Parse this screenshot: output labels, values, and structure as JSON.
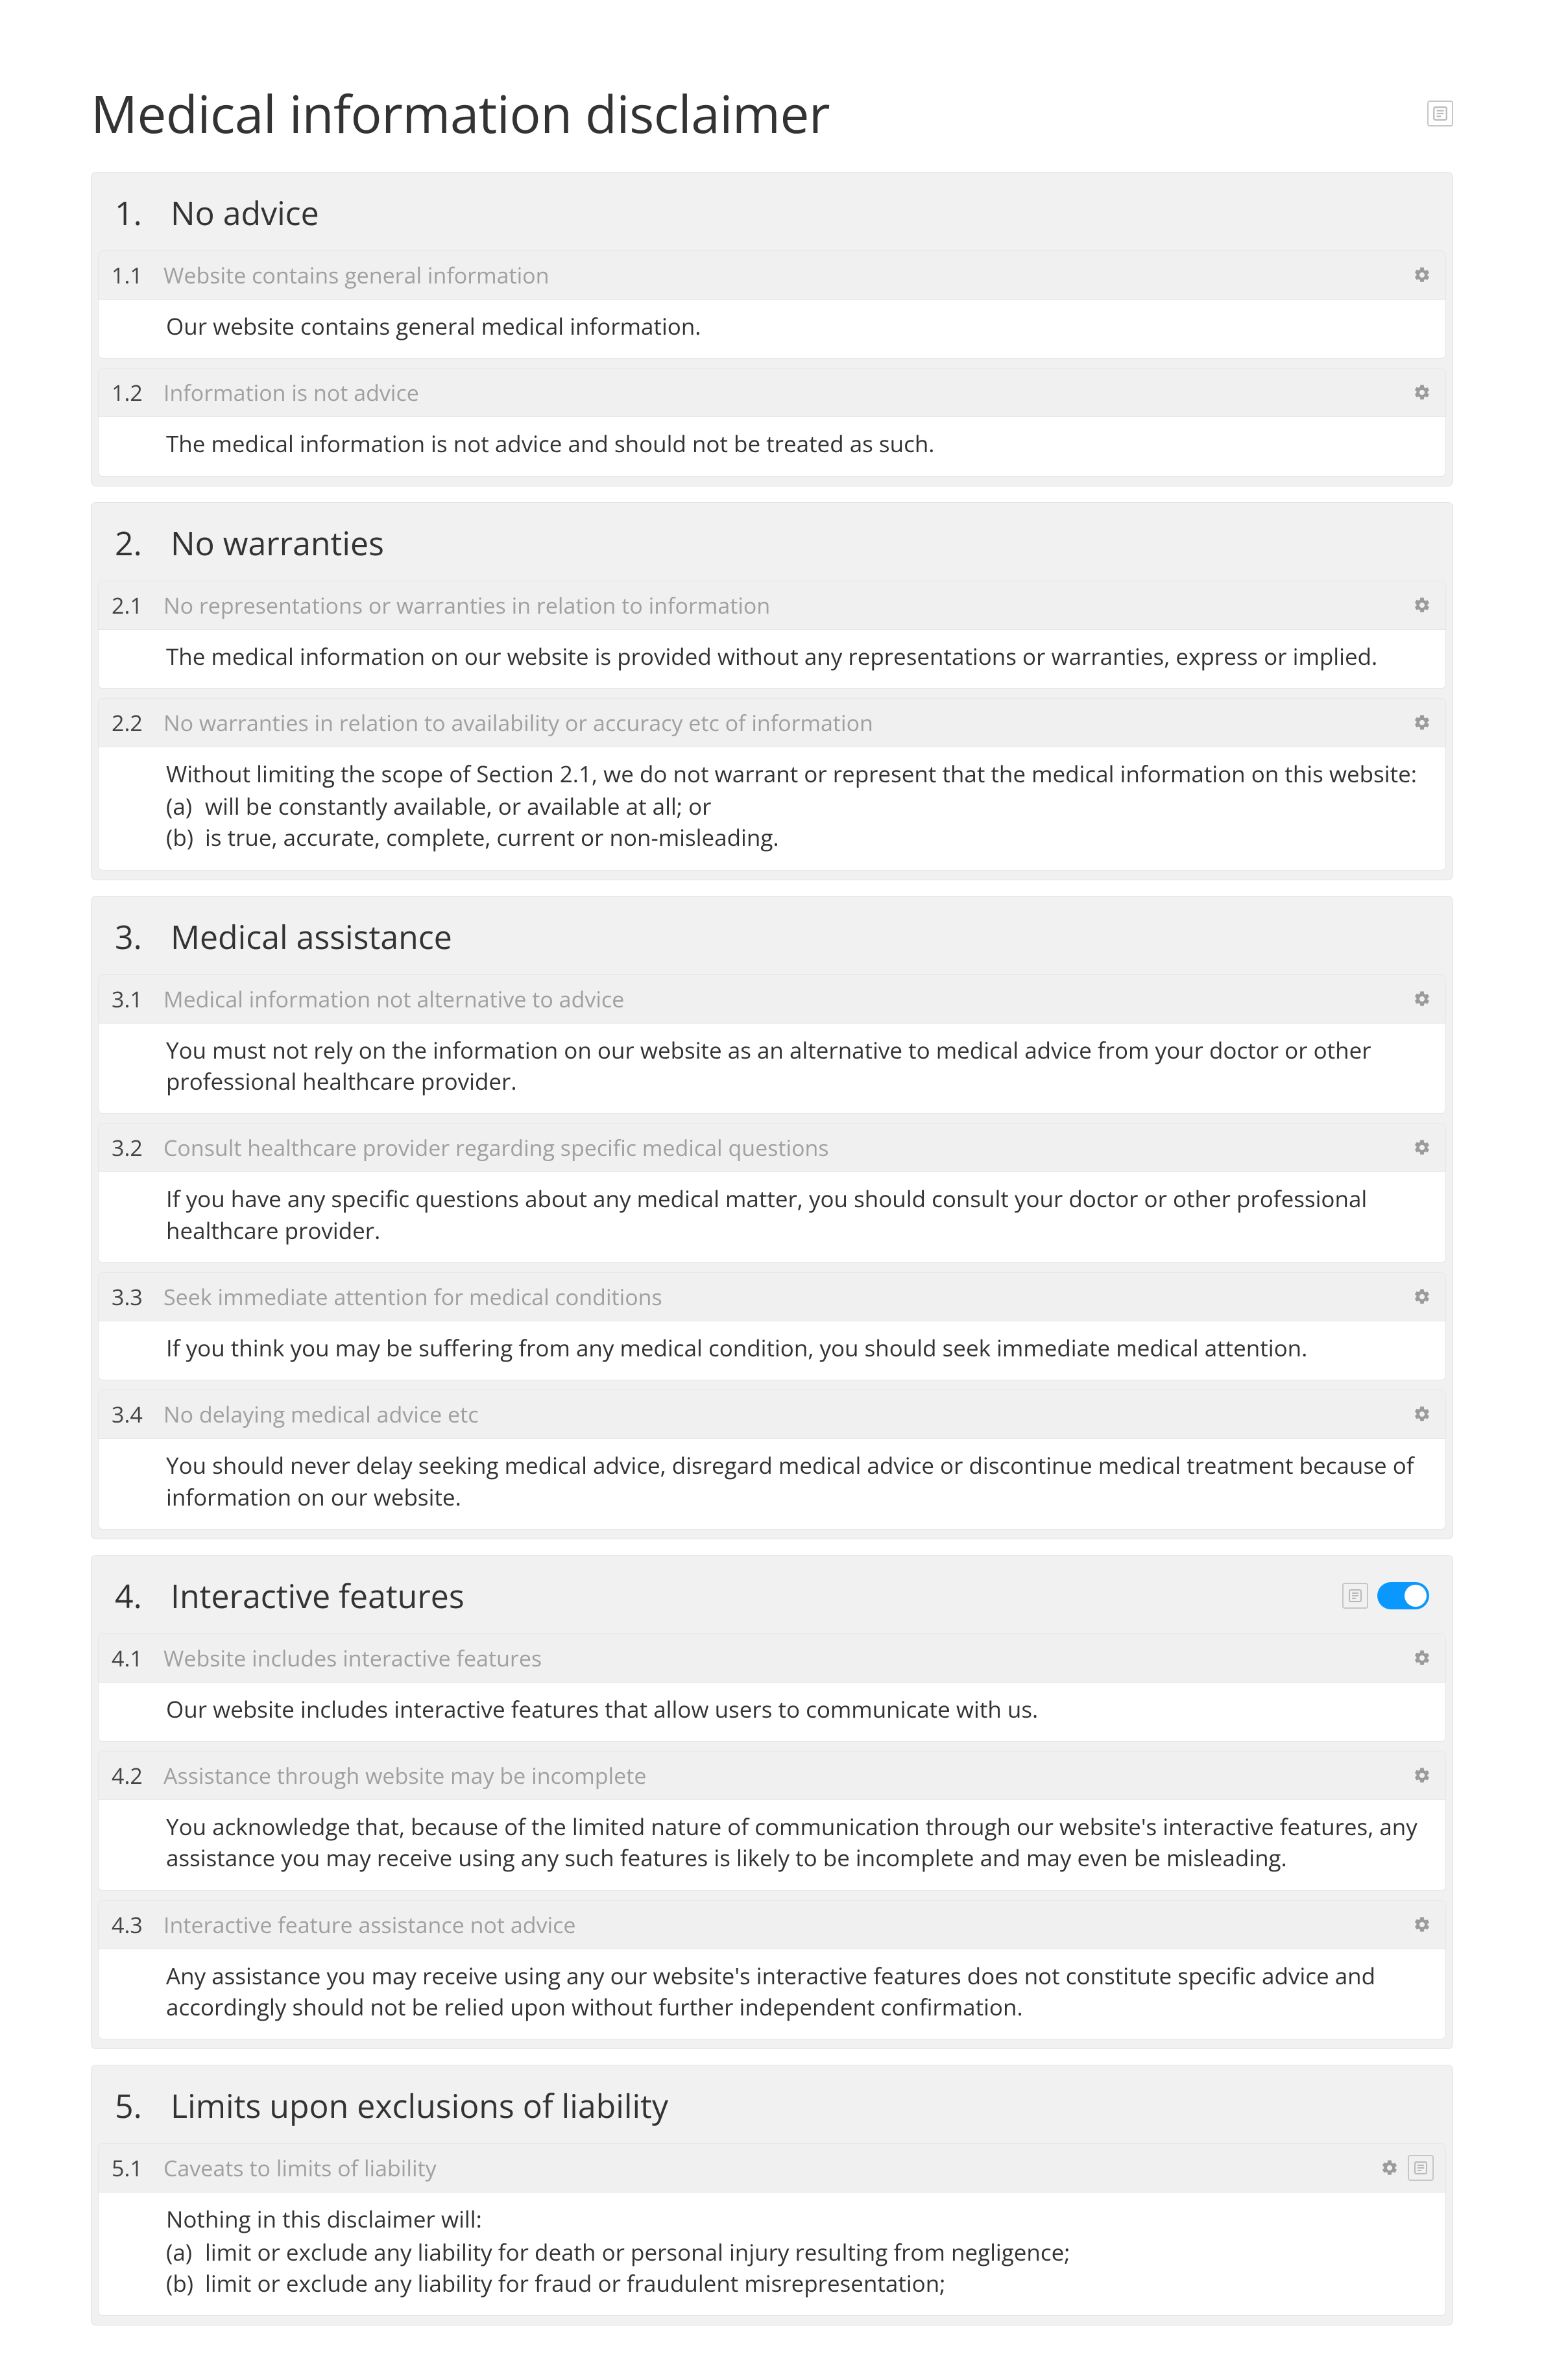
{
  "page_title": "Medical information disclaimer",
  "sections": [
    {
      "num": "1.",
      "title": "No advice",
      "has_toggle": false,
      "has_notes_icon": false,
      "clauses": [
        {
          "num": "1.1",
          "title": "Website contains general information",
          "body_intro": "Our website contains general medical information.",
          "items": [],
          "has_notes_icon": false
        },
        {
          "num": "1.2",
          "title": "Information is not advice",
          "body_intro": "The medical information is not advice and should not be treated as such.",
          "items": [],
          "has_notes_icon": false
        }
      ]
    },
    {
      "num": "2.",
      "title": "No warranties",
      "has_toggle": false,
      "has_notes_icon": false,
      "clauses": [
        {
          "num": "2.1",
          "title": "No representations or warranties in relation to information",
          "body_intro": "The medical information on our website is provided without any representations or warranties, express or implied.",
          "items": [],
          "has_notes_icon": false
        },
        {
          "num": "2.2",
          "title": "No warranties in relation to availability or accuracy etc of information",
          "body_intro": "Without limiting the scope of Section 2.1, we do not warrant or represent that the medical information on this website:",
          "items": [
            "will be constantly available, or available at all; or",
            "is true, accurate, complete, current or non-misleading."
          ],
          "has_notes_icon": false
        }
      ]
    },
    {
      "num": "3.",
      "title": "Medical assistance",
      "has_toggle": false,
      "has_notes_icon": false,
      "clauses": [
        {
          "num": "3.1",
          "title": "Medical information not alternative to advice",
          "body_intro": "You must not rely on the information on our website as an alternative to medical advice from your doctor or other professional healthcare provider.",
          "items": [],
          "has_notes_icon": false
        },
        {
          "num": "3.2",
          "title": "Consult healthcare provider regarding specific medical questions",
          "body_intro": "If you have any specific questions about any medical matter, you should consult your doctor or other professional healthcare provider.",
          "items": [],
          "has_notes_icon": false
        },
        {
          "num": "3.3",
          "title": "Seek immediate attention for medical conditions",
          "body_intro": "If you think you may be suffering from any medical condition, you should seek immediate medical attention.",
          "items": [],
          "has_notes_icon": false
        },
        {
          "num": "3.4",
          "title": "No delaying medical advice etc",
          "body_intro": "You should never delay seeking medical advice, disregard medical advice or discontinue medical treatment because of information on our website.",
          "items": [],
          "has_notes_icon": false
        }
      ]
    },
    {
      "num": "4.",
      "title": "Interactive features",
      "has_toggle": true,
      "has_notes_icon": true,
      "clauses": [
        {
          "num": "4.1",
          "title": "Website includes interactive features",
          "body_intro": "Our website includes interactive features that allow users to communicate with us.",
          "items": [],
          "has_notes_icon": false
        },
        {
          "num": "4.2",
          "title": "Assistance through website may be incomplete",
          "body_intro": "You acknowledge that, because of the limited nature of communication through our website's interactive features, any assistance you may receive using any such features is likely to be incomplete and may even be misleading.",
          "items": [],
          "has_notes_icon": false
        },
        {
          "num": "4.3",
          "title": "Interactive feature assistance not advice",
          "body_intro": "Any assistance you may receive using any our website's interactive features does not constitute specific advice and accordingly should not be relied upon without further independent confirmation.",
          "items": [],
          "has_notes_icon": false
        }
      ]
    },
    {
      "num": "5.",
      "title": "Limits upon exclusions of liability",
      "has_toggle": false,
      "has_notes_icon": false,
      "clauses": [
        {
          "num": "5.1",
          "title": "Caveats to limits of liability",
          "body_intro": "Nothing in this disclaimer will:",
          "items": [
            "limit or exclude any liability for death or personal injury resulting from negligence;",
            "limit or exclude any liability for fraud or fraudulent misrepresentation;"
          ],
          "has_notes_icon": true
        }
      ]
    }
  ]
}
